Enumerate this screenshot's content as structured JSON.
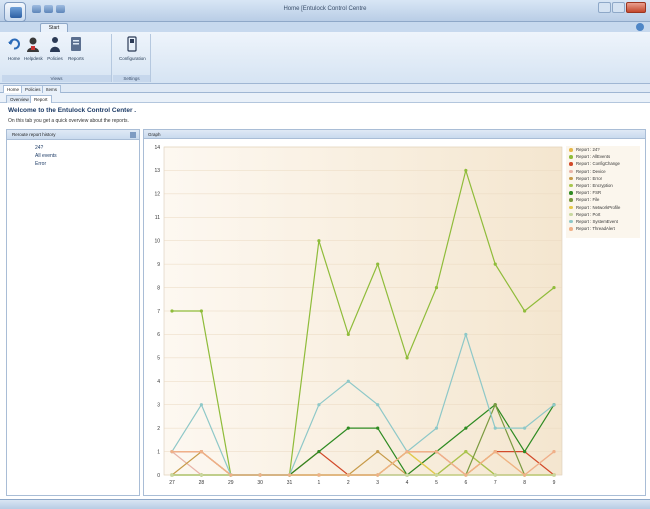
{
  "window": {
    "title": "Home [Entulock Control Centre"
  },
  "ribbon": {
    "tab_label": "Start",
    "groups": [
      {
        "label": "Views",
        "buttons": [
          "Home",
          "Helpdesk",
          "Policies",
          "Reports"
        ]
      },
      {
        "label": "Settings",
        "buttons": [
          "Configuration"
        ]
      }
    ]
  },
  "view_tabs": [
    "Home",
    "Policies",
    "Items"
  ],
  "page_tabs": [
    "Overview",
    "Report"
  ],
  "welcome": {
    "title": "Welcome to the Entulock Control Center .",
    "subtitle": "On this tab you get a quick overview about the reports."
  },
  "left_panel": {
    "header": "Reroute report history",
    "items": [
      "24?",
      "All events",
      "Error"
    ]
  },
  "right_panel": {
    "header": "Graph"
  },
  "chart_data": {
    "type": "line",
    "x": [
      "27",
      "28",
      "29",
      "30",
      "31",
      "1",
      "2",
      "3",
      "4",
      "5",
      "6",
      "7",
      "8",
      "9"
    ],
    "ylim": [
      0,
      14
    ],
    "yticks": [
      0,
      1,
      2,
      3,
      4,
      5,
      6,
      7,
      8,
      9,
      10,
      11,
      12,
      13,
      14
    ],
    "grid": true,
    "legend_position": "top-right",
    "series": [
      {
        "name": "Report : 24?",
        "color": "#e6b84a",
        "values": [
          0,
          0,
          0,
          0,
          0,
          0,
          0,
          0,
          0,
          0,
          0,
          0,
          0,
          0
        ]
      },
      {
        "name": "Report : AllEvents",
        "color": "#8fbc3a",
        "values": [
          7,
          7,
          0,
          0,
          0,
          10,
          6,
          9,
          5,
          8,
          13,
          9,
          7,
          8
        ]
      },
      {
        "name": "Report : ConfigChange",
        "color": "#d24a2a",
        "values": [
          1,
          1,
          0,
          0,
          0,
          1,
          0,
          0,
          1,
          1,
          0,
          1,
          1,
          0
        ]
      },
      {
        "name": "Report : Device",
        "color": "#e8b4a8",
        "values": [
          1,
          0,
          0,
          0,
          0,
          0,
          0,
          0,
          0,
          1,
          0,
          0,
          0,
          1
        ]
      },
      {
        "name": "Report : Error",
        "color": "#c79b4a",
        "values": [
          0,
          1,
          0,
          0,
          0,
          0,
          0,
          1,
          0,
          0,
          1,
          0,
          0,
          0
        ]
      },
      {
        "name": "Report : Encryption",
        "color": "#a8c64e",
        "values": [
          0,
          0,
          0,
          0,
          0,
          0,
          0,
          0,
          1,
          0,
          1,
          0,
          0,
          0
        ]
      },
      {
        "name": "Report : FSR",
        "color": "#2e8b22",
        "values": [
          0,
          0,
          0,
          0,
          0,
          1,
          2,
          2,
          0,
          1,
          2,
          3,
          1,
          3
        ]
      },
      {
        "name": "Report : File",
        "color": "#7a9a40",
        "values": [
          0,
          0,
          0,
          0,
          0,
          0,
          0,
          0,
          0,
          0,
          0,
          3,
          0,
          0
        ]
      },
      {
        "name": "Report : NetworkProfile",
        "color": "#e6c94a",
        "values": [
          0,
          0,
          0,
          0,
          0,
          0,
          0,
          0,
          1,
          0,
          0,
          1,
          0,
          0
        ]
      },
      {
        "name": "Report : Port",
        "color": "#c8d8a0",
        "values": [
          0,
          0,
          0,
          0,
          0,
          0,
          0,
          0,
          0,
          0,
          0,
          0,
          0,
          0
        ]
      },
      {
        "name": "Report : SystemEvent",
        "color": "#8ec8c8",
        "values": [
          1,
          3,
          0,
          0,
          0,
          3,
          4,
          3,
          1,
          2,
          6,
          2,
          2,
          3
        ]
      },
      {
        "name": "Report : ThreadAlert",
        "color": "#f0b088",
        "values": [
          1,
          1,
          0,
          0,
          0,
          0,
          0,
          0,
          1,
          1,
          0,
          1,
          0,
          1
        ]
      }
    ]
  }
}
